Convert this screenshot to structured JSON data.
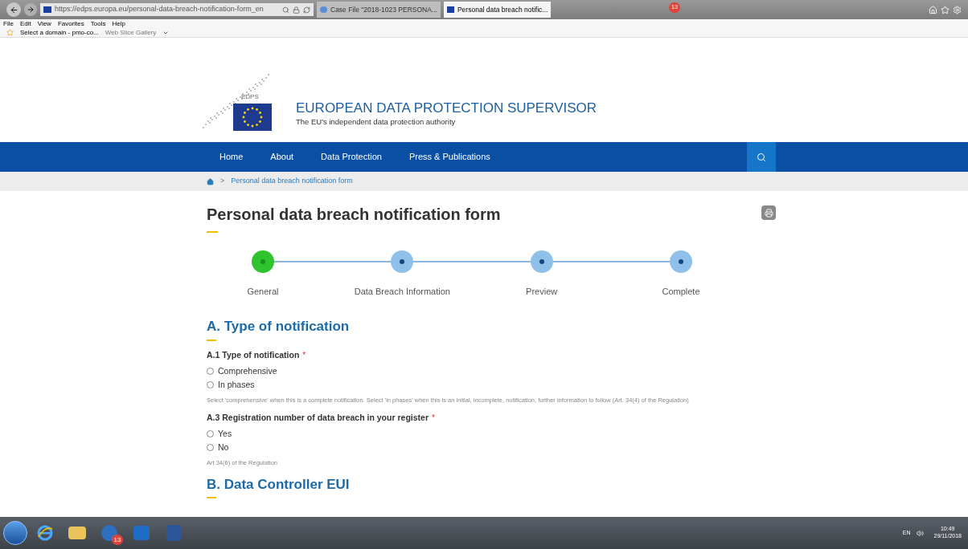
{
  "browser": {
    "address": "https://edps.europa.eu/personal-data-breach-notification-form_en",
    "tabs": [
      {
        "label": "Case File \"2018-1023 PERSONA...",
        "selected": false
      },
      {
        "label": "Personal data breach notific...",
        "selected": true
      }
    ],
    "menu": [
      "File",
      "Edit",
      "View",
      "Favorites",
      "Tools",
      "Help"
    ],
    "favorites": [
      "Select a domain - pmo-co...",
      "Web Slice Gallery"
    ],
    "notification_count": "13"
  },
  "site": {
    "title": "EUROPEAN DATA PROTECTION SUPERVISOR",
    "subtitle": "The EU's independent data protection authority",
    "logo_text": "EDPS",
    "nav": [
      "Home",
      "About",
      "Data Protection",
      "Press & Publications"
    ],
    "breadcrumb": [
      {
        "separator": ">",
        "label": "Personal data breach notification form"
      }
    ]
  },
  "page": {
    "title": "Personal data breach notification form",
    "steps": [
      {
        "label": "General",
        "selected": true
      },
      {
        "label": "Data Breach Information",
        "selected": false
      },
      {
        "label": "Preview",
        "selected": false
      },
      {
        "label": "Complete",
        "selected": false
      }
    ],
    "sections": [
      {
        "title": "A. Type of notification",
        "questions": [
          {
            "label": "A.1 Type of notification",
            "required_mark": "*",
            "options": [
              {
                "label": "Comprehensive",
                "checked": false
              },
              {
                "label": "In phases",
                "checked": false
              }
            ],
            "help": "Select 'comprehensive' when this is a complete notification. Select 'in phases' when this is an initial, incomplete, notification, further information to follow (Art. 34(4) of the Regulation)"
          },
          {
            "label": "A.3 Registration number of data breach in your register",
            "required_mark": "*",
            "options": [
              {
                "label": "Yes",
                "checked": false
              },
              {
                "label": "No",
                "checked": false
              }
            ],
            "help": "Art 34(6) of the Regulation"
          }
        ]
      },
      {
        "title": "B. Data Controller EUI"
      }
    ]
  },
  "taskbar": {
    "badge": "13",
    "language": "EN",
    "time": "10:49",
    "date": "29/11/2018"
  }
}
